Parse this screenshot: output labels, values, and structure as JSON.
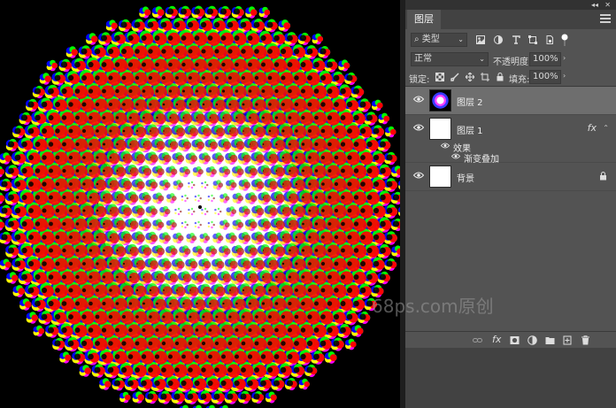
{
  "panel": {
    "tab_label": "图层",
    "filter": {
      "selected": "类型"
    },
    "blend_mode": {
      "selected": "正常"
    },
    "opacity": {
      "label": "不透明度:",
      "value": "100%"
    },
    "lock": {
      "label": "锁定:"
    },
    "fill": {
      "label": "填充:",
      "value": "100%"
    },
    "layers": [
      {
        "name": "图层 2",
        "selected": true,
        "thumbnail": "halftone-thumbnail"
      },
      {
        "name": "图层 1",
        "selected": false,
        "fx_label": "fx",
        "effects_label": "效果",
        "effect_items": [
          "渐变叠加"
        ]
      },
      {
        "name": "背景",
        "selected": false,
        "locked": true
      }
    ]
  },
  "watermark": "68ps.com原创",
  "icons": {
    "filter": [
      "image-filter-icon",
      "adjustment-filter-icon",
      "type-filter-icon",
      "shape-filter-icon",
      "smart-object-filter-icon",
      "filter-toggle-icon"
    ],
    "lock": [
      "lock-transparent-icon",
      "lock-image-icon",
      "lock-position-icon",
      "lock-artboard-icon",
      "lock-all-icon"
    ],
    "bottom": [
      "link-layers-icon",
      "fx-icon",
      "add-mask-icon",
      "adjustment-layer-icon",
      "new-group-icon",
      "new-layer-icon",
      "delete-layer-icon"
    ]
  },
  "colors": {
    "panel_bg": "#535353",
    "selected_row": "#6e6e6e",
    "halftone": [
      "#ffffff",
      "#ff00ff",
      "#00ffff",
      "#ffff00",
      "#00ff00",
      "#ff0000",
      "#0000ff"
    ]
  }
}
